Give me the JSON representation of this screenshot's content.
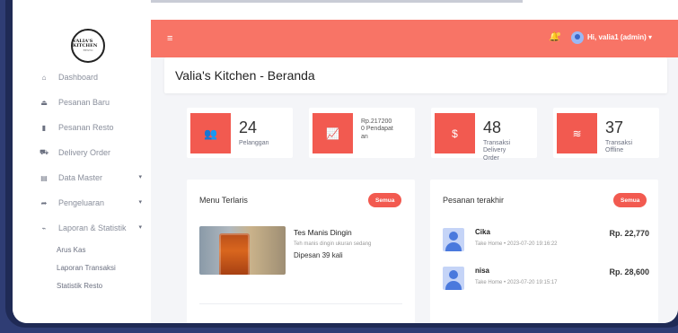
{
  "brand": {
    "logo_line1": "VALIA'S KITCHEN",
    "logo_line2": "RESTO"
  },
  "sidebar": {
    "items": [
      {
        "label": "Dashboard",
        "icon": "home-icon",
        "glyph": "⌂"
      },
      {
        "label": "Pesanan Baru",
        "icon": "eject-icon",
        "glyph": "⏏"
      },
      {
        "label": "Pesanan Resto",
        "icon": "clipboard-icon",
        "glyph": "▮"
      },
      {
        "label": "Delivery Order",
        "icon": "truck-icon",
        "glyph": "⛟"
      },
      {
        "label": "Data Master",
        "icon": "database-icon",
        "glyph": "▤",
        "caret": "▾"
      },
      {
        "label": "Pengeluaran",
        "icon": "export-icon",
        "glyph": "➦",
        "caret": "▾"
      },
      {
        "label": "Laporan & Statistik",
        "icon": "chart-line-icon",
        "glyph": "⌁",
        "caret": "▾"
      }
    ],
    "subitems": [
      {
        "label": "Arus Kas"
      },
      {
        "label": "Laporan Transaksi"
      },
      {
        "label": "Statistik Resto"
      }
    ]
  },
  "header": {
    "menu_glyph": "≡",
    "bell_glyph": "🔔",
    "user_label": "Hi, valia1 (admin) ▾"
  },
  "page": {
    "title": "Valia's Kitchen - Beranda"
  },
  "stats": [
    {
      "value": "24",
      "label": "Pelanggan",
      "icon": "users-icon",
      "glyph": "👥"
    },
    {
      "value": "Rp.2172000",
      "label": "Pendapatan",
      "icon": "chart-area-icon",
      "glyph": "📈"
    },
    {
      "value": "48",
      "label": "Transaksi Delivery Order",
      "icon": "money-icon",
      "glyph": "$"
    },
    {
      "value": "37",
      "label": "Transaksi Offline",
      "icon": "lines-icon",
      "glyph": "≋"
    }
  ],
  "menu_terlaris": {
    "title": "Menu Terlaris",
    "button": "Semua",
    "item": {
      "name": "Tes Manis Dingin",
      "desc": "Teh manis dingin ukuran sedang",
      "ordered": "Dipesan 39 kali"
    }
  },
  "pesanan_terakhir": {
    "title": "Pesanan terakhir",
    "button": "Semua",
    "orders": [
      {
        "name": "Cika",
        "meta": "Take Home  •  2023-07-20 19:16:22",
        "amount": "Rp. 22,770"
      },
      {
        "name": "nisa",
        "meta": "Take Home  •  2023-07-20 19:15:17",
        "amount": "Rp. 28,600"
      }
    ]
  },
  "colors": {
    "accent": "#f87466",
    "button": "#f25a50"
  }
}
